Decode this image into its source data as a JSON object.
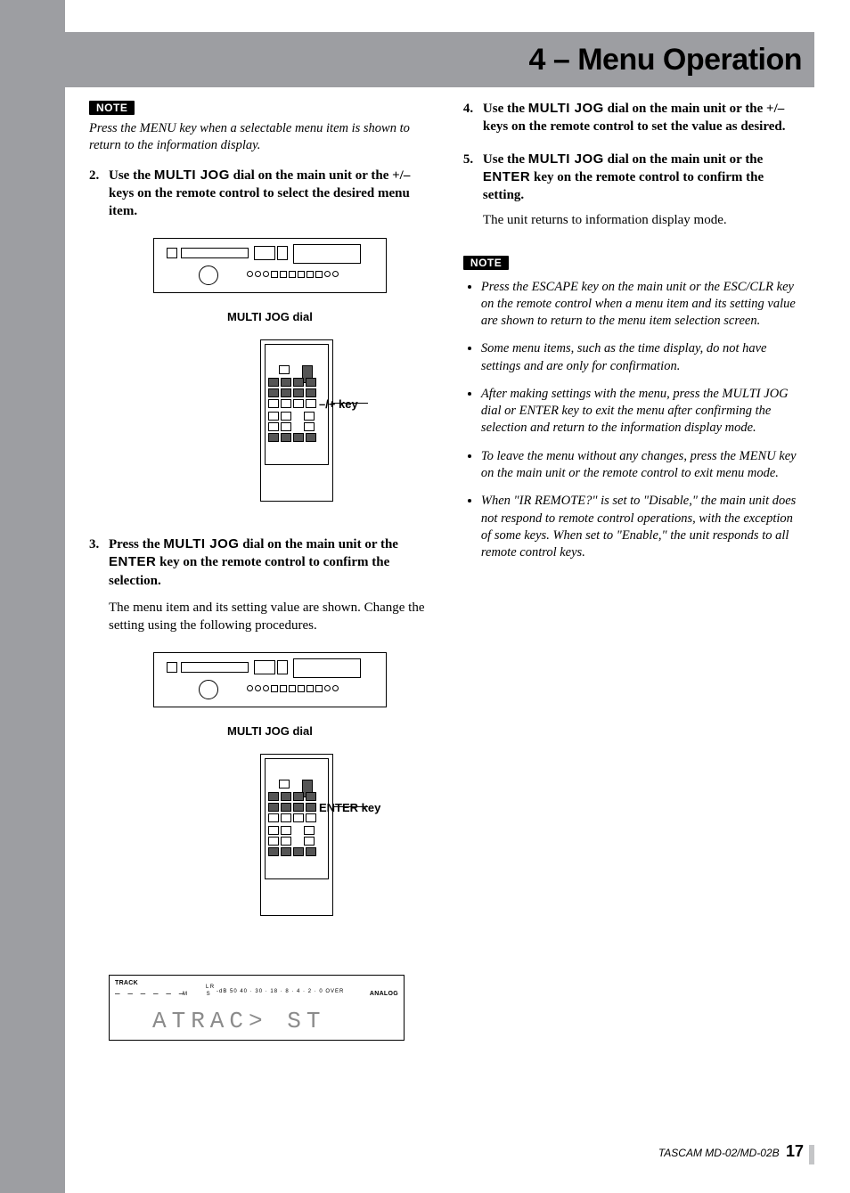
{
  "header": {
    "title": "4 – Menu Operation"
  },
  "left": {
    "note1_tag": "NOTE",
    "note1_text": "Press the MENU key when a selectable menu item is shown to return to the information display.",
    "step2_num": "2.",
    "step2_a": "Use the ",
    "step2_sc": "MULTI JOG",
    "step2_b": " dial on the main unit or the +/– keys on the remote control to select the desired menu item.",
    "caption1": "MULTI JOG dial",
    "remote1_label": "–/+ key",
    "step3_num": "3.",
    "step3_a": "Press the ",
    "step3_sc1": "MULTI JOG",
    "step3_b": " dial on the main unit or the ",
    "step3_sc2": "ENTER",
    "step3_c": " key on the remote control to confirm the selection.",
    "step3_sub": "The menu item and its setting value are shown. Change the setting using the following procedures.",
    "caption2": "MULTI JOG dial",
    "remote2_label": "ENTER key",
    "lcd": {
      "track": "TRACK",
      "dashes": "– – –   – – –",
      "msr": "M S",
      "lr": "L\nR",
      "scale_major": "-dB 50 40 · 30 · 18 · 8 · 4 · 2 · 0 OVER",
      "analog": "ANALOG",
      "seg": "ATRAC>  ST"
    }
  },
  "right": {
    "step4_num": "4.",
    "step4_a": "Use the ",
    "step4_sc": "MULTI JOG",
    "step4_b": " dial on the main unit or the +/– keys on the remote control to set the value as desired.",
    "step5_num": "5.",
    "step5_a": "Use the ",
    "step5_sc1": "MULTI JOG",
    "step5_b": " dial on the main unit or the ",
    "step5_sc2": "ENTER",
    "step5_c": " key on the remote control to confirm the setting.",
    "step5_plain": "The unit returns to information display mode.",
    "note2_tag": "NOTE",
    "bullets": [
      "Press the ESCAPE key on the main unit or the ESC/CLR key on the remote control when a menu item and its setting value are shown to return to the menu item selection screen.",
      "Some menu items, such as the time display, do not have settings and are only for confirmation.",
      "After making settings with the menu, press the MULTI JOG dial or ENTER key to exit the menu after confirming the selection and return to the information display mode.",
      "To leave the menu without any changes, press the MENU key on the main unit or the remote control to exit menu mode.",
      "When \"IR REMOTE?\" is set to \"Disable,\" the main unit does not respond to remote control operations, with the exception of some keys. When set to \"Enable,\" the unit responds to all remote control keys."
    ]
  },
  "footer": {
    "model": "TASCAM  MD-02/MD-02B",
    "page": "17"
  }
}
